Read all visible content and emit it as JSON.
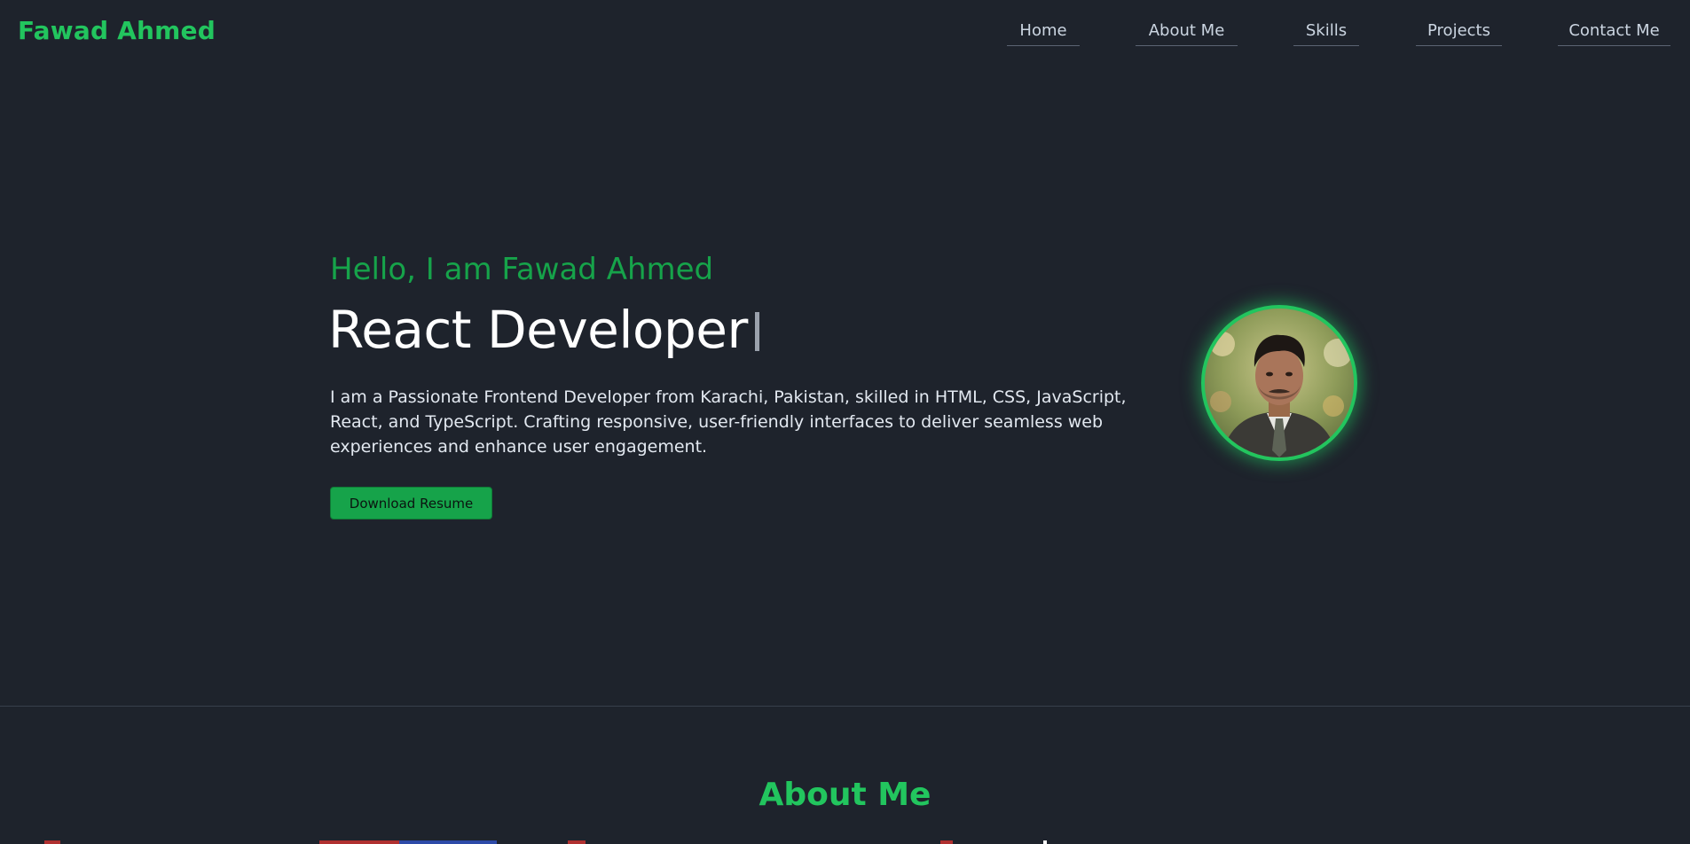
{
  "brand": {
    "name": "Fawad Ahmed"
  },
  "nav": {
    "items": [
      {
        "label": "Home"
      },
      {
        "label": "About Me"
      },
      {
        "label": "Skills"
      },
      {
        "label": "Projects"
      },
      {
        "label": "Contact Me"
      }
    ]
  },
  "hero": {
    "greeting": "Hello, I am Fawad Ahmed",
    "title": "React Developer",
    "description": "I am a Passionate Frontend Developer from Karachi, Pakistan, skilled in HTML, CSS, JavaScript, React, and TypeScript. Crafting responsive, user-friendly interfaces to deliver seamless web experiences and enhance user engagement.",
    "resume_button": "Download Resume"
  },
  "about": {
    "heading": "About Me"
  },
  "colors": {
    "background": "#1e232c",
    "accent": "#22c55e",
    "button": "#16a34a"
  }
}
